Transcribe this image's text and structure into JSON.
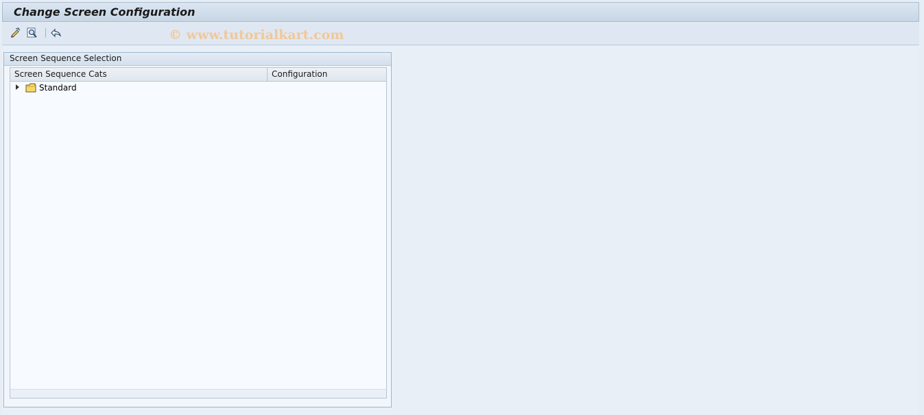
{
  "window": {
    "title": "Change Screen Configuration"
  },
  "toolbar": {
    "buttons": [
      {
        "icon": "change-pencil-icon"
      },
      {
        "icon": "display-search-icon"
      },
      {
        "icon": "undo-arrow-icon"
      }
    ]
  },
  "watermark": {
    "text": "© www.tutorialkart.com"
  },
  "group": {
    "title": "Screen Sequence Selection",
    "tree": {
      "columns": [
        "Screen Sequence Cats",
        "Configuration"
      ],
      "nodes": [
        {
          "label": "Standard",
          "icon": "folder-icon",
          "expanded": false,
          "configuration": ""
        }
      ]
    }
  },
  "colors": {
    "background": "#e6edf5",
    "panel": "#f7faff",
    "border": "#9db6d0",
    "folder": "#f7d96b"
  }
}
